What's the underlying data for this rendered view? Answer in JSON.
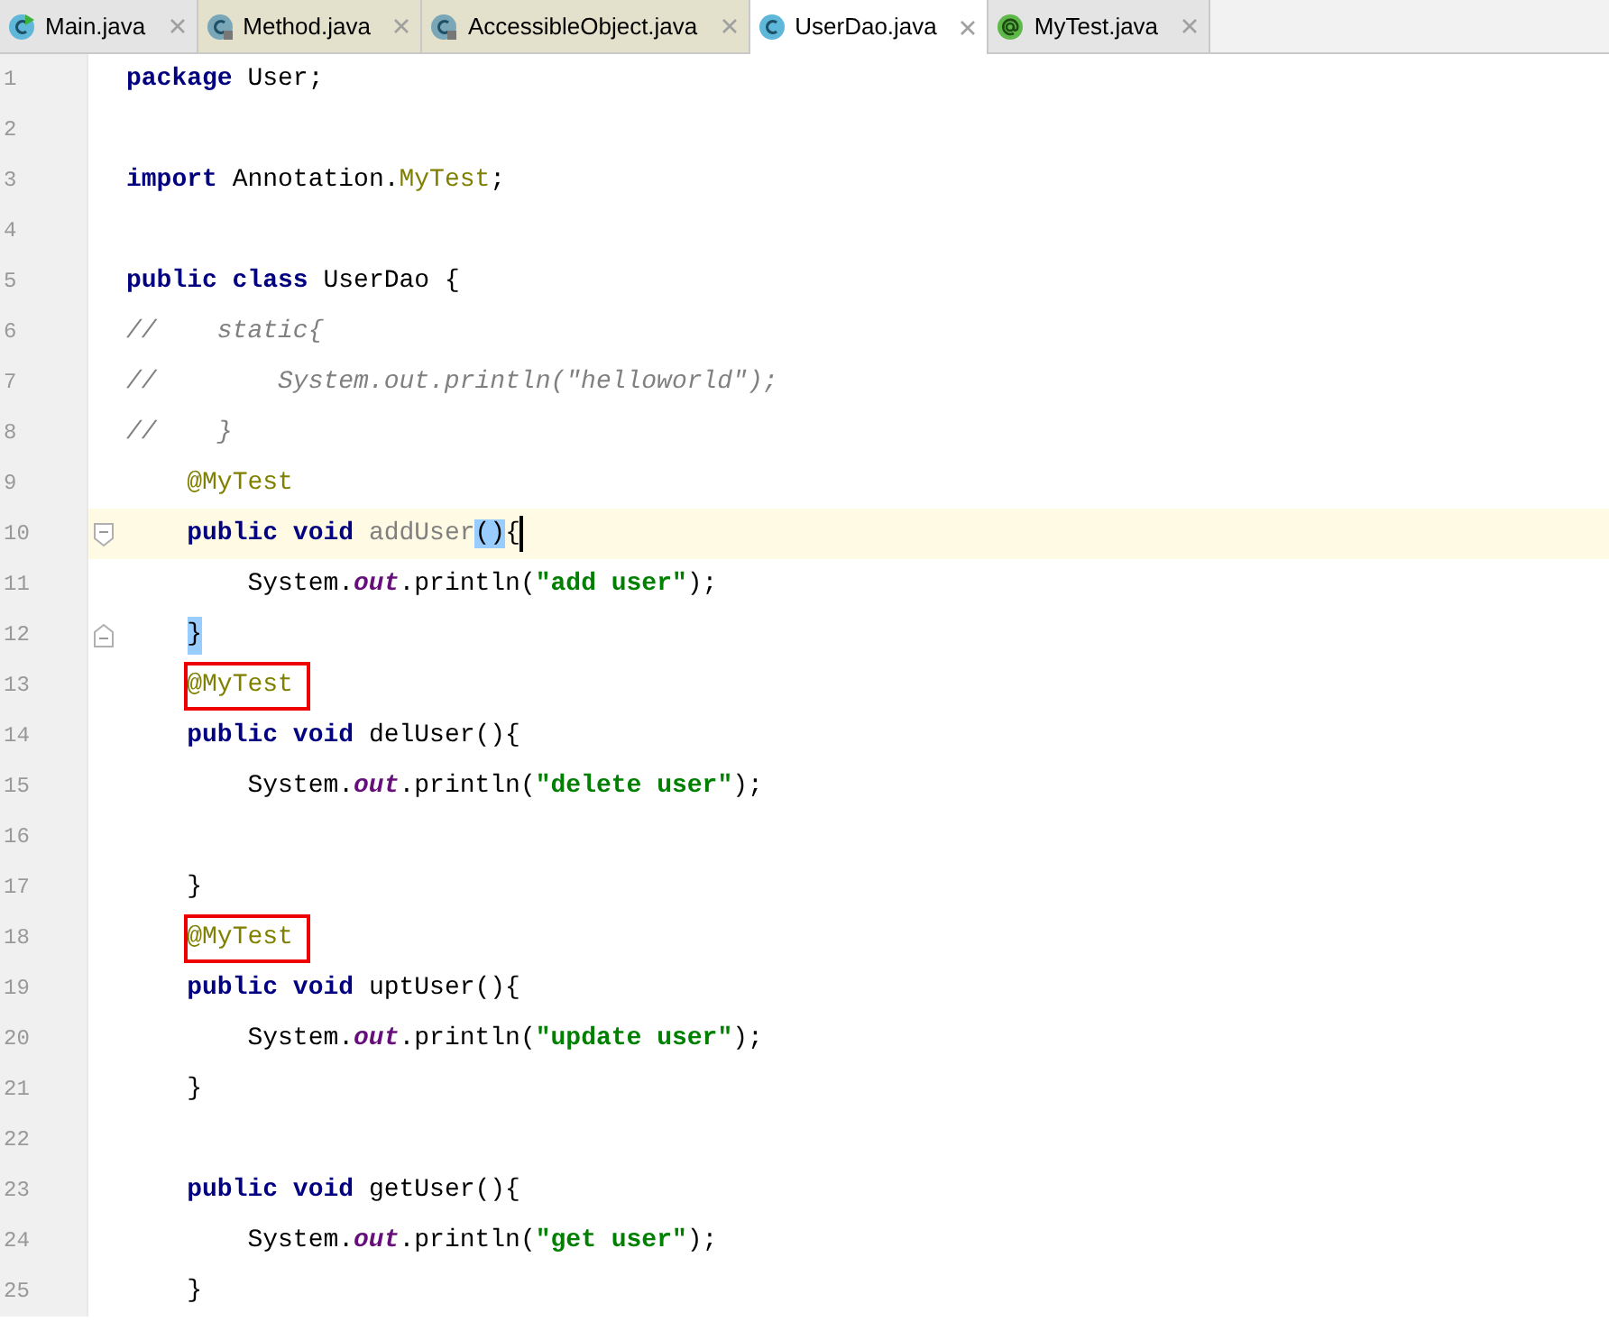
{
  "tabs": [
    {
      "label": "Main.java",
      "kind": "main-class",
      "readonly": false,
      "selected": false
    },
    {
      "label": "Method.java",
      "kind": "locked-class",
      "readonly": true,
      "selected": false
    },
    {
      "label": "AccessibleObject.java",
      "kind": "locked-class",
      "readonly": true,
      "selected": false
    },
    {
      "label": "UserDao.java",
      "kind": "class",
      "readonly": false,
      "selected": true
    },
    {
      "label": "MyTest.java",
      "kind": "annotation",
      "readonly": false,
      "selected": false
    }
  ],
  "lines": [
    {
      "number": "1",
      "tokens": [
        {
          "kind": "keyword",
          "text": "package"
        },
        {
          "kind": "plain",
          "text": " User;"
        }
      ]
    },
    {
      "number": "2"
    },
    {
      "number": "3",
      "tokens": [
        {
          "kind": "keyword",
          "text": "import"
        },
        {
          "kind": "plain",
          "text": " Annotation."
        },
        {
          "kind": "annotation",
          "text": "MyTest"
        },
        {
          "kind": "plain",
          "text": ";"
        }
      ]
    },
    {
      "number": "4"
    },
    {
      "number": "5",
      "tokens": [
        {
          "kind": "keyword",
          "text": "public class"
        },
        {
          "kind": "plain",
          "text": " UserDao {"
        }
      ]
    },
    {
      "number": "6",
      "tokens": [
        {
          "kind": "comment",
          "text": "//    static{"
        }
      ]
    },
    {
      "number": "7",
      "tokens": [
        {
          "kind": "comment",
          "text": "//        System.out.println(\"helloworld\");"
        }
      ]
    },
    {
      "number": "8",
      "tokens": [
        {
          "kind": "comment",
          "text": "//    }"
        }
      ]
    },
    {
      "number": "9",
      "tokens": [
        {
          "kind": "annotation",
          "text": "    @MyTest"
        }
      ]
    },
    {
      "number": "10",
      "current": true,
      "caret": true,
      "fold_open": true,
      "tokens": [
        {
          "kind": "keyword",
          "text": "    public void"
        },
        {
          "kind": "unused",
          "text": " addUser"
        },
        {
          "kind": "match",
          "text": "()"
        },
        {
          "kind": "plain",
          "text": "{"
        }
      ]
    },
    {
      "number": "11",
      "tokens": [
        {
          "kind": "plain",
          "text": "        System."
        },
        {
          "kind": "static",
          "text": "out"
        },
        {
          "kind": "plain",
          "text": ".println("
        },
        {
          "kind": "string",
          "text": "\"add user\""
        },
        {
          "kind": "plain",
          "text": ");"
        }
      ]
    },
    {
      "number": "12",
      "fold_close": true,
      "tokens": [
        {
          "kind": "match",
          "text": "    }"
        }
      ]
    },
    {
      "number": "13",
      "tokens": [
        {
          "kind": "marked-annotation",
          "text": "    @MyTest"
        }
      ]
    },
    {
      "number": "14",
      "tokens": [
        {
          "kind": "keyword",
          "text": "    public void"
        },
        {
          "kind": "plain",
          "text": " delUser(){"
        }
      ]
    },
    {
      "number": "15",
      "tokens": [
        {
          "kind": "plain",
          "text": "        System."
        },
        {
          "kind": "static",
          "text": "out"
        },
        {
          "kind": "plain",
          "text": ".println("
        },
        {
          "kind": "string",
          "text": "\"delete user\""
        },
        {
          "kind": "plain",
          "text": ");"
        }
      ]
    },
    {
      "number": "16"
    },
    {
      "number": "17",
      "tokens": [
        {
          "kind": "plain",
          "text": "    }"
        }
      ]
    },
    {
      "number": "18",
      "tokens": [
        {
          "kind": "marked-annotation",
          "text": "    @MyTest"
        }
      ]
    },
    {
      "number": "19",
      "tokens": [
        {
          "kind": "keyword",
          "text": "    public void"
        },
        {
          "kind": "plain",
          "text": " uptUser(){"
        }
      ]
    },
    {
      "number": "20",
      "tokens": [
        {
          "kind": "plain",
          "text": "        System."
        },
        {
          "kind": "static",
          "text": "out"
        },
        {
          "kind": "plain",
          "text": ".println("
        },
        {
          "kind": "string",
          "text": "\"update user\""
        },
        {
          "kind": "plain",
          "text": ");"
        }
      ]
    },
    {
      "number": "21",
      "tokens": [
        {
          "kind": "plain",
          "text": "    }"
        }
      ]
    },
    {
      "number": "22"
    },
    {
      "number": "23",
      "tokens": [
        {
          "kind": "keyword",
          "text": "    public void"
        },
        {
          "kind": "plain",
          "text": " getUser(){"
        }
      ]
    },
    {
      "number": "24",
      "tokens": [
        {
          "kind": "plain",
          "text": "        System."
        },
        {
          "kind": "static",
          "text": "out"
        },
        {
          "kind": "plain",
          "text": ".println("
        },
        {
          "kind": "string",
          "text": "\"get user\""
        },
        {
          "kind": "plain",
          "text": ");"
        }
      ]
    },
    {
      "number": "25",
      "tokens": [
        {
          "kind": "plain",
          "text": "    }"
        }
      ]
    }
  ]
}
